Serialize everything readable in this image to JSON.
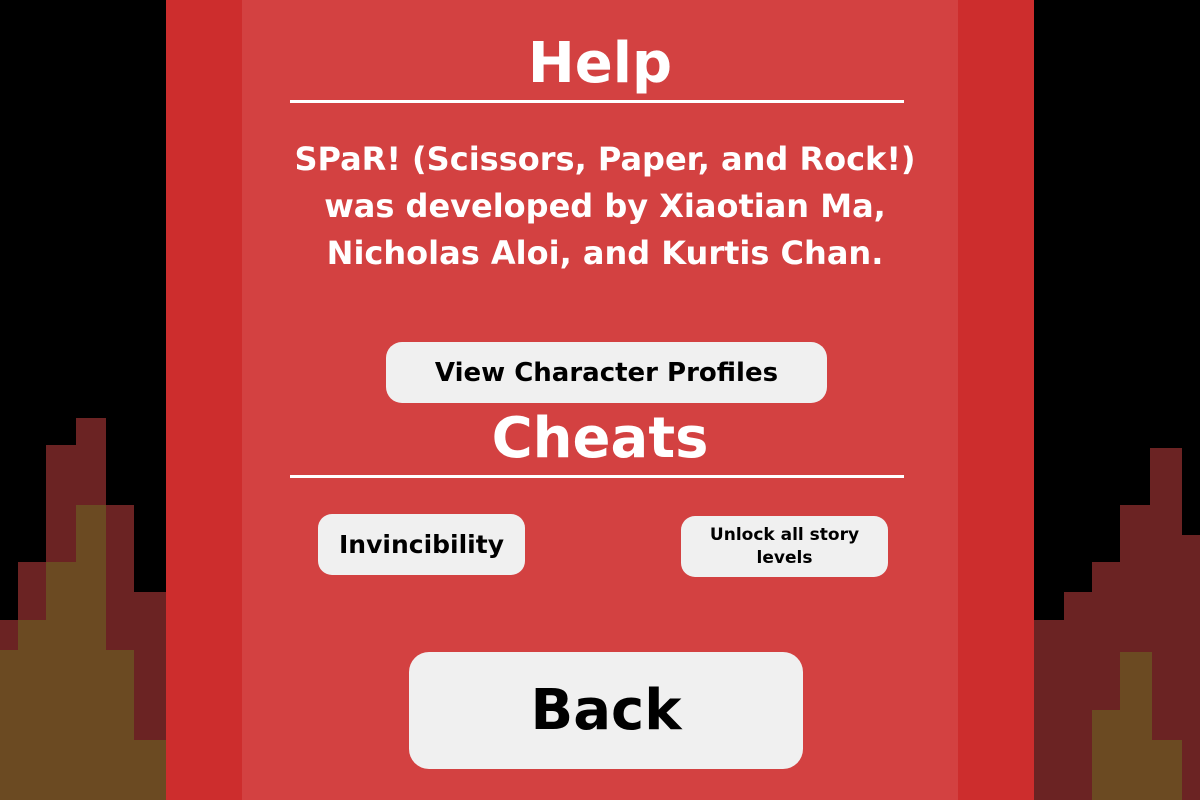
{
  "colors": {
    "background": "#000000",
    "outer_panel": "#cd2d2d",
    "inner_panel": "#d34141",
    "fire_dark": "#6b2323",
    "fire_light": "#6b4a22",
    "button_bg": "#f0f0f0",
    "text": "#ffffff"
  },
  "help": {
    "title": "Help",
    "credits": "SPaR! (Scissors, Paper, and Rock!) was developed by Xiaotian Ma, Nicholas Aloi, and Kurtis Chan.",
    "profiles_button": "View Character Profiles"
  },
  "cheats": {
    "title": "Cheats",
    "invincibility_button": "Invincibility",
    "unlock_button": "Unlock all story levels"
  },
  "back_button": "Back"
}
